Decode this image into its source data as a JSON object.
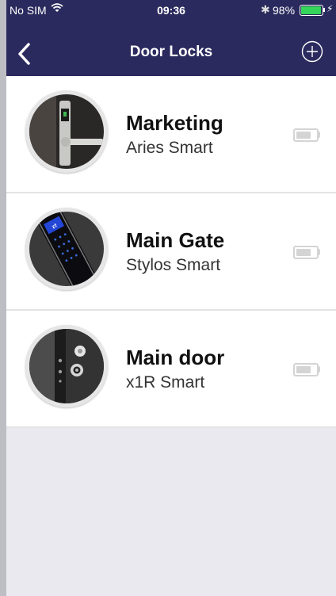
{
  "status_bar": {
    "carrier": "No SIM",
    "time": "09:36",
    "battery_percent": "98%",
    "battery_level": 0.98,
    "icons": [
      "wifi-icon",
      "bluetooth-icon",
      "battery-icon",
      "charging-icon"
    ]
  },
  "nav": {
    "title": "Door Locks",
    "back_icon": "chevron-left-icon",
    "add_icon": "plus-circle-icon"
  },
  "locks": [
    {
      "name": "Marketing",
      "model": "Aries Smart",
      "image": "lever-handle-lock",
      "battery_icon": "battery-icon",
      "battery_level": 0.9
    },
    {
      "name": "Main Gate",
      "model": "Stylos Smart",
      "image": "keypad-lock",
      "battery_icon": "battery-icon",
      "battery_level": 0.9
    },
    {
      "name": "Main door",
      "model": "x1R Smart",
      "image": "door-edge-lock",
      "battery_icon": "battery-icon",
      "battery_level": 0.9
    }
  ],
  "colors": {
    "header_bg": "#2b2a5e",
    "battery_green": "#35d45a",
    "list_bg": "#ffffff",
    "empty_bg": "#e9e9ef",
    "battery_gray": "#d4d4d4"
  }
}
